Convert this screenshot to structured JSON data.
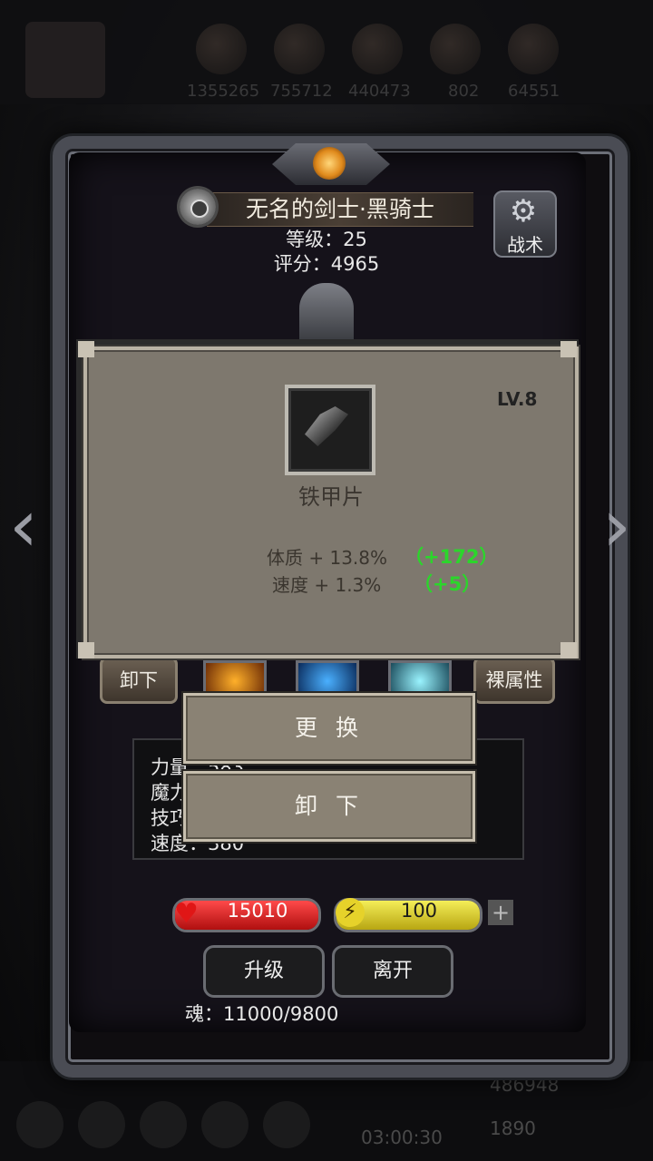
{
  "top_resources": [
    "1355265",
    "755712",
    "440473",
    "802",
    "64551"
  ],
  "header": {
    "name": "无名的剑士·黑骑士",
    "level": "等级：25",
    "score": "评分：4965",
    "tactic_label": "战术"
  },
  "item": {
    "level": "LV.8",
    "name": "铁甲片",
    "attributes": [
      {
        "text": "体质 + 13.8%",
        "bonus": "（+172）"
      },
      {
        "text": "速度 + 1.3%",
        "bonus": "（+5）"
      }
    ]
  },
  "equip_row": {
    "unequip_label": "卸下",
    "naked_attr_label": "裸属性"
  },
  "menu": {
    "replace_label": "更 换",
    "unequip_label": "卸 下"
  },
  "stats": {
    "strength": "力量：583",
    "magic": "魔力",
    "skill": "技巧",
    "speed": "速度：380"
  },
  "bars": {
    "hp": "15010",
    "hp_fraction": 1.0,
    "energy": "100",
    "energy_fraction": 1.0
  },
  "buttons": {
    "upgrade": "升级",
    "leave": "离开"
  },
  "soul": "魂：11000/9800",
  "bottom": {
    "gold": "486948",
    "gems": "1890",
    "timer": "03:00:30"
  },
  "colors": {
    "bonus_green": "#2bd62b",
    "hp_red": "#d61a1a",
    "energy_yellow": "#e6d22a"
  }
}
